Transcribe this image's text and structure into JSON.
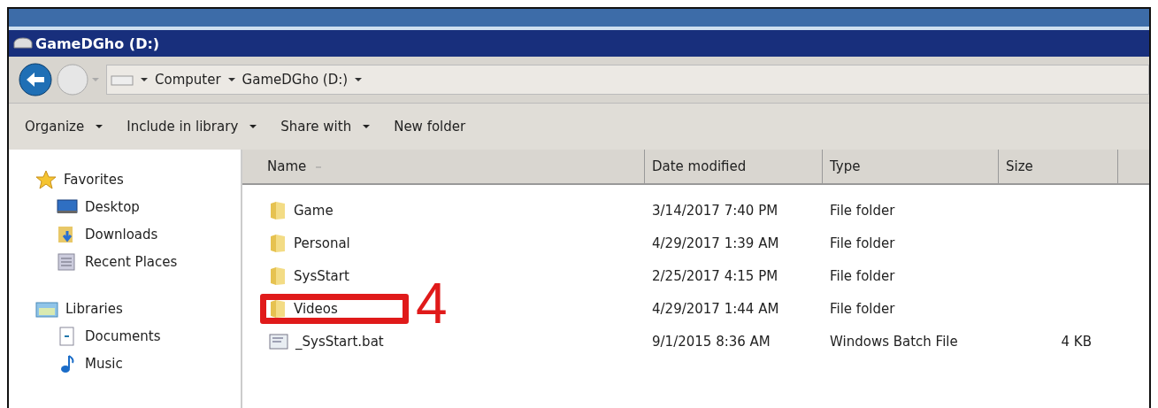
{
  "window": {
    "title": "GameDGho (D:)"
  },
  "address_bar": {
    "crumbs": [
      "Computer",
      "GameDGho (D:)"
    ]
  },
  "toolbar": [
    {
      "label": "Organize",
      "dropdown": true
    },
    {
      "label": "Include in library",
      "dropdown": true
    },
    {
      "label": "Share with",
      "dropdown": true
    },
    {
      "label": "New folder",
      "dropdown": false
    }
  ],
  "nav_pane": [
    {
      "label": "Favorites",
      "kind": "favorites",
      "children": [
        {
          "label": "Desktop",
          "kind": "desktop"
        },
        {
          "label": "Downloads",
          "kind": "downloads"
        },
        {
          "label": "Recent Places",
          "kind": "recent"
        }
      ]
    },
    {
      "label": "Libraries",
      "kind": "libraries",
      "children": [
        {
          "label": "Documents",
          "kind": "documents"
        },
        {
          "label": "Music",
          "kind": "music"
        }
      ]
    }
  ],
  "table": {
    "columns": [
      "Name",
      "Date modified",
      "Type",
      "Size"
    ],
    "rows": [
      {
        "name": "Game",
        "kind": "folder",
        "date": "3/14/2017 7:40 PM",
        "type": "File folder",
        "annotated": false
      },
      {
        "name": "Personal",
        "kind": "folder",
        "date": "4/29/2017 1:39 AM",
        "type": "File folder",
        "annotated": false
      },
      {
        "name": "SysStart",
        "kind": "folder",
        "date": "2/25/2017 4:15 PM",
        "type": "File folder",
        "annotated": false
      },
      {
        "name": "Videos",
        "kind": "folder",
        "date": "4/29/2017 1:44 AM",
        "type": "File folder",
        "annotated": true,
        "annotation_label": "4"
      },
      {
        "name": "_SysStart.bat",
        "kind": "batch",
        "date": "9/1/2015 8:36 AM",
        "type": "Windows Batch File",
        "size": "4 KB",
        "annotated": false
      }
    ]
  }
}
